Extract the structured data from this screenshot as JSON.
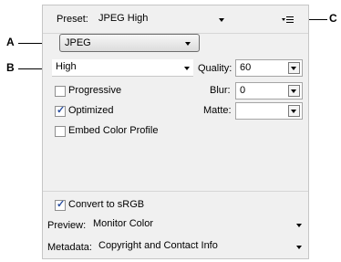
{
  "callouts": {
    "a": "A",
    "b": "B",
    "c": "C"
  },
  "preset": {
    "label": "Preset:",
    "value": "JPEG High"
  },
  "menu_icon": "panel-menu-icon",
  "format": {
    "value": "JPEG"
  },
  "quality_level": {
    "value": "High"
  },
  "quality": {
    "label": "Quality:",
    "value": "60"
  },
  "blur": {
    "label": "Blur:",
    "value": "0"
  },
  "matte": {
    "label": "Matte:",
    "value": ""
  },
  "options": {
    "progressive": {
      "label": "Progressive",
      "checked": false
    },
    "optimized": {
      "label": "Optimized",
      "checked": true
    },
    "embed_profile": {
      "label": "Embed Color Profile",
      "checked": false
    }
  },
  "convert_srgb": {
    "label": "Convert to sRGB",
    "checked": true
  },
  "preview": {
    "label": "Preview:",
    "value": "Monitor Color"
  },
  "metadata": {
    "label": "Metadata:",
    "value": "Copyright and Contact Info"
  }
}
